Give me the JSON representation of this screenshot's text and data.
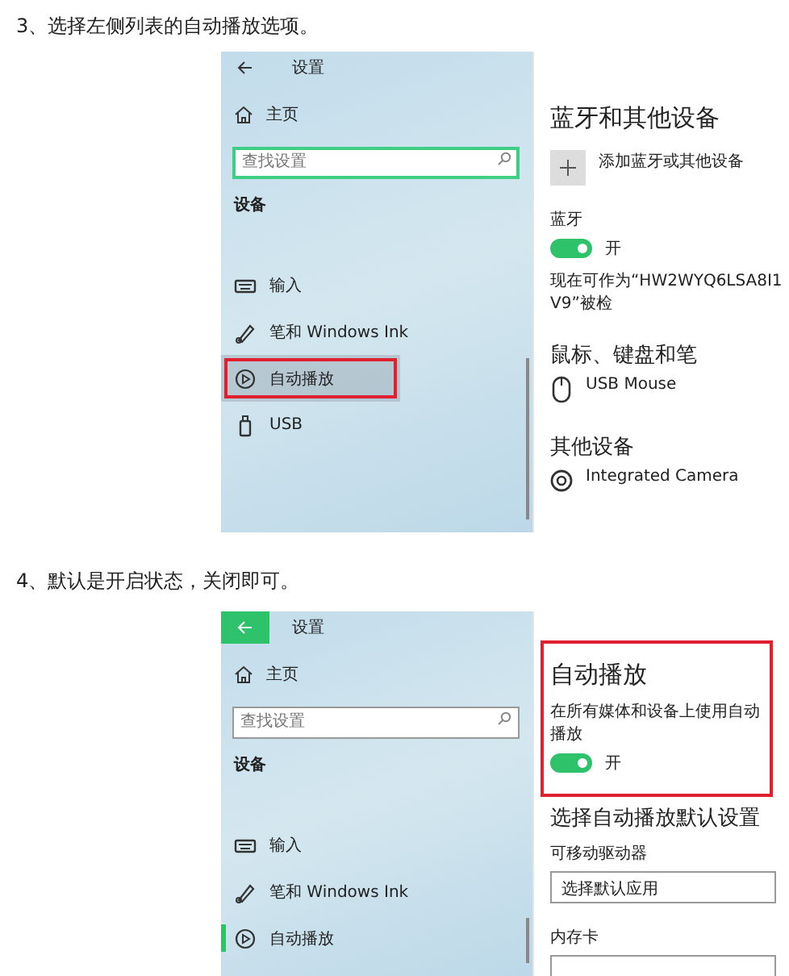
{
  "steps": [
    {
      "instruction": "3、选择左侧列表的自动播放选项。",
      "screenshot": {
        "back_button": {
          "active": false
        },
        "title": "设置",
        "home": "主页",
        "search": {
          "placeholder": "查找设置",
          "focused": true
        },
        "section": "设备",
        "items": [
          {
            "kind": "keyboard",
            "label": "输入",
            "selected": false,
            "hovered": false,
            "annotated": false
          },
          {
            "kind": "pen",
            "label": "笔和 Windows Ink",
            "selected": false,
            "hovered": false,
            "annotated": false
          },
          {
            "kind": "autoplay",
            "label": "自动播放",
            "selected": false,
            "hovered": true,
            "annotated": true
          },
          {
            "kind": "usb",
            "label": "USB",
            "selected": false,
            "hovered": false,
            "annotated": false
          }
        ],
        "content": [
          {
            "kind": "heading",
            "text": "蓝牙和其他设备"
          },
          {
            "kind": "add",
            "text": "添加蓝牙或其他设备"
          },
          {
            "kind": "label",
            "text": "蓝牙"
          },
          {
            "kind": "toggle",
            "on": true,
            "text": "开"
          },
          {
            "kind": "note",
            "text": "现在可作为“HW2WYQ6LSA8I1V9”被检"
          },
          {
            "kind": "subheading",
            "text": "鼠标、键盘和笔"
          },
          {
            "kind": "mouse",
            "text": "USB Mouse"
          },
          {
            "kind": "subheading",
            "text": "其他设备"
          },
          {
            "kind": "camera",
            "text": "Integrated Camera"
          }
        ]
      }
    },
    {
      "instruction": "4、默认是开启状态，关闭即可。",
      "screenshot": {
        "back_button": {
          "active": true
        },
        "title": "设置",
        "home": "主页",
        "search": {
          "placeholder": "查找设置",
          "focused": false
        },
        "section": "设备",
        "items": [
          {
            "kind": "keyboard",
            "label": "输入",
            "selected": false,
            "hovered": false,
            "annotated": false
          },
          {
            "kind": "pen",
            "label": "笔和 Windows Ink",
            "selected": false,
            "hovered": false,
            "annotated": false
          },
          {
            "kind": "autoplay",
            "label": "自动播放",
            "selected": true,
            "hovered": false,
            "annotated": false
          }
        ],
        "content": [
          {
            "kind": "callout",
            "children": [
              {
                "kind": "heading",
                "text": "自动播放"
              },
              {
                "kind": "label",
                "text": "在所有媒体和设备上使用自动播放"
              },
              {
                "kind": "toggle",
                "on": true,
                "text": "开"
              }
            ]
          },
          {
            "kind": "subheading",
            "text": "选择自动播放默认设置"
          },
          {
            "kind": "label",
            "text": "可移动驱动器"
          },
          {
            "kind": "dropdown",
            "value": "选择默认应用"
          },
          {
            "kind": "label",
            "text": "内存卡"
          },
          {
            "kind": "dropdown"
          }
        ]
      }
    }
  ]
}
